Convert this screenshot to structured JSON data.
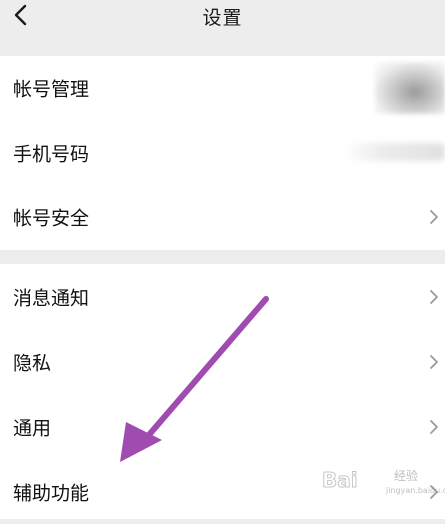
{
  "header": {
    "title": "设置"
  },
  "groups": [
    {
      "items": [
        {
          "label": "帐号管理",
          "chevron": false
        },
        {
          "label": "手机号码",
          "chevron": false
        },
        {
          "label": "帐号安全",
          "chevron": true
        }
      ]
    },
    {
      "items": [
        {
          "label": "消息通知",
          "chevron": true
        },
        {
          "label": "隐私",
          "chevron": true
        },
        {
          "label": "通用",
          "chevron": true
        },
        {
          "label": "辅助功能",
          "chevron": true
        }
      ]
    }
  ],
  "annotation": {
    "arrow_color": "#a04bb0"
  },
  "watermark": {
    "brand": "Bai",
    "brand_suffix": "经验",
    "url": "jingyan.baidu.com"
  }
}
